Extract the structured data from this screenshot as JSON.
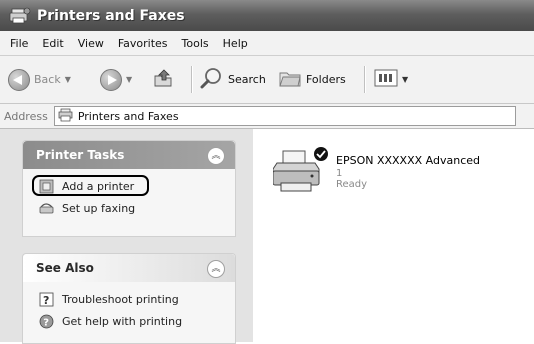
{
  "window": {
    "title": "Printers and Faxes",
    "icon": "printers-folder-icon"
  },
  "menu": [
    "File",
    "Edit",
    "View",
    "Favorites",
    "Tools",
    "Help"
  ],
  "toolbar": {
    "back_label": "Back",
    "search_label": "Search",
    "folders_label": "Folders",
    "icons": [
      "back-icon",
      "forward-icon",
      "up-folder-icon",
      "search-icon",
      "folders-icon",
      "views-icon"
    ]
  },
  "address": {
    "label": "Address",
    "value": "Printers and Faxes"
  },
  "printer_tasks": {
    "title": "Printer Tasks",
    "items": [
      {
        "label": "Add a printer",
        "icon": "add-printer-icon"
      },
      {
        "label": "Set up faxing",
        "icon": "fax-icon"
      }
    ]
  },
  "see_also": {
    "title": "See Also",
    "items": [
      {
        "label": "Troubleshoot printing",
        "icon": "help-question-icon"
      },
      {
        "label": "Get help with printing",
        "icon": "help-globe-icon"
      }
    ]
  },
  "printer": {
    "name": "EPSON XXXXXX  Advanced",
    "documents": "1",
    "status": "Ready",
    "icon": "printer-default-icon"
  },
  "colors": {
    "title_bar": "#5e5e5e",
    "task_pane": "#e3e3e3",
    "highlight_ring": "#000000"
  }
}
